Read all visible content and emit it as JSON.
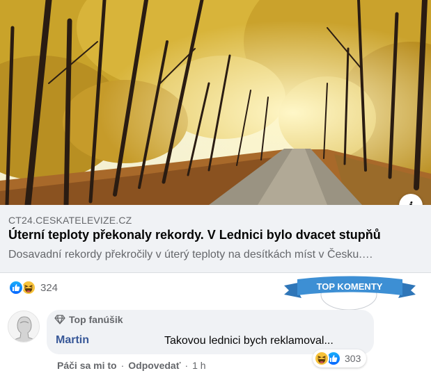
{
  "post": {
    "image_alt": "Autumn alley with yellow trees",
    "link": {
      "domain": "CT24.CESKATELEVIZE.CZ",
      "title": "Úterní teploty překonaly rekordy. V Lednici bylo dvacet stupňů",
      "description": "Dosavadní rekordy překročily v úterý teploty na desítkách míst v Česku.…"
    },
    "info_icon": "i",
    "reactions": {
      "icons": [
        "like-icon",
        "haha-icon"
      ],
      "count": "324"
    }
  },
  "banner": {
    "label": "TOP KOMENTY",
    "color": "#3d8fd4"
  },
  "comment": {
    "badge_icon": "diamond-icon",
    "badge": "Top fanúšik",
    "author": "Martin",
    "text": "Takovou lednici bych reklamoval...",
    "reactions": {
      "icons": [
        "haha-icon",
        "like-icon"
      ],
      "count": "303"
    },
    "actions": {
      "like": "Páči sa mi to",
      "separator": "·",
      "reply": "Odpovedať",
      "time": "1 h"
    }
  },
  "colors": {
    "like": "#0866ff",
    "haha": "#f7c23a",
    "author": "#385898",
    "muted": "#65676b"
  }
}
